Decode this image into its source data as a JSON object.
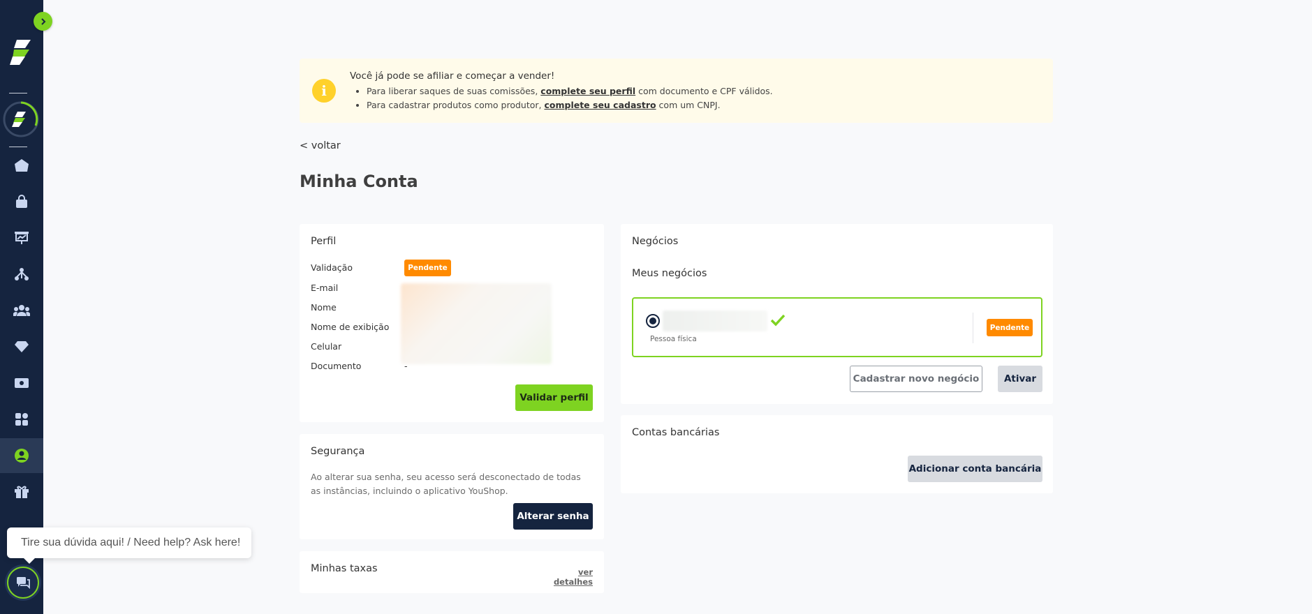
{
  "banner": {
    "title": "Você já pode se afiliar e começar a vender!",
    "line1_pre": "Para liberar saques de suas comissões, ",
    "line1_link": "complete seu perfil",
    "line1_post": " com documento e CPF válidos.",
    "line2_pre": "Para cadastrar produtos como produtor, ",
    "line2_link": "complete seu cadastro",
    "line2_post": " com um CNPJ."
  },
  "back_label": "< voltar",
  "page_title": "Minha Conta",
  "perfil": {
    "title": "Perfil",
    "validacao_label": "Validação",
    "validacao_status": "Pendente",
    "email_label": "E-mail",
    "nome_label": "Nome",
    "nome_exibicao_label": "Nome de exibição",
    "celular_label": "Celular",
    "documento_label": "Documento",
    "documento_value": "-",
    "validar_button": "Validar perfil"
  },
  "seguranca": {
    "title": "Segurança",
    "description": "Ao alterar sua senha, seu acesso será desconectado de todas as instâncias, incluindo o aplicativo YouShop.",
    "alterar_button": "Alterar senha"
  },
  "taxas": {
    "title": "Minhas taxas",
    "details_link": "ver detalhes"
  },
  "negocios": {
    "title": "Negócios",
    "subtitle": "Meus negócios",
    "business_type": "Pessoa física",
    "business_status": "Pendente",
    "new_button": "Cadastrar novo negócio",
    "activate_button": "Ativar"
  },
  "contas": {
    "title": "Contas bancárias",
    "add_button": "Adicionar conta bancária"
  },
  "help_tip": "Tire sua dúvida aqui! / Need help? Ask here!",
  "colors": {
    "sidebar": "#15243f",
    "accent": "#7ed321",
    "pending": "#ff8a00",
    "banner_bg": "#fffbea",
    "info_icon": "#ffd12b"
  },
  "sidebar_icons": [
    "home-icon",
    "shopping-bag-icon",
    "presentation-chart-icon",
    "network-icon",
    "users-icon",
    "diamond-icon",
    "money-icon",
    "apps-grid-icon",
    "account-circle-icon",
    "gift-icon"
  ]
}
